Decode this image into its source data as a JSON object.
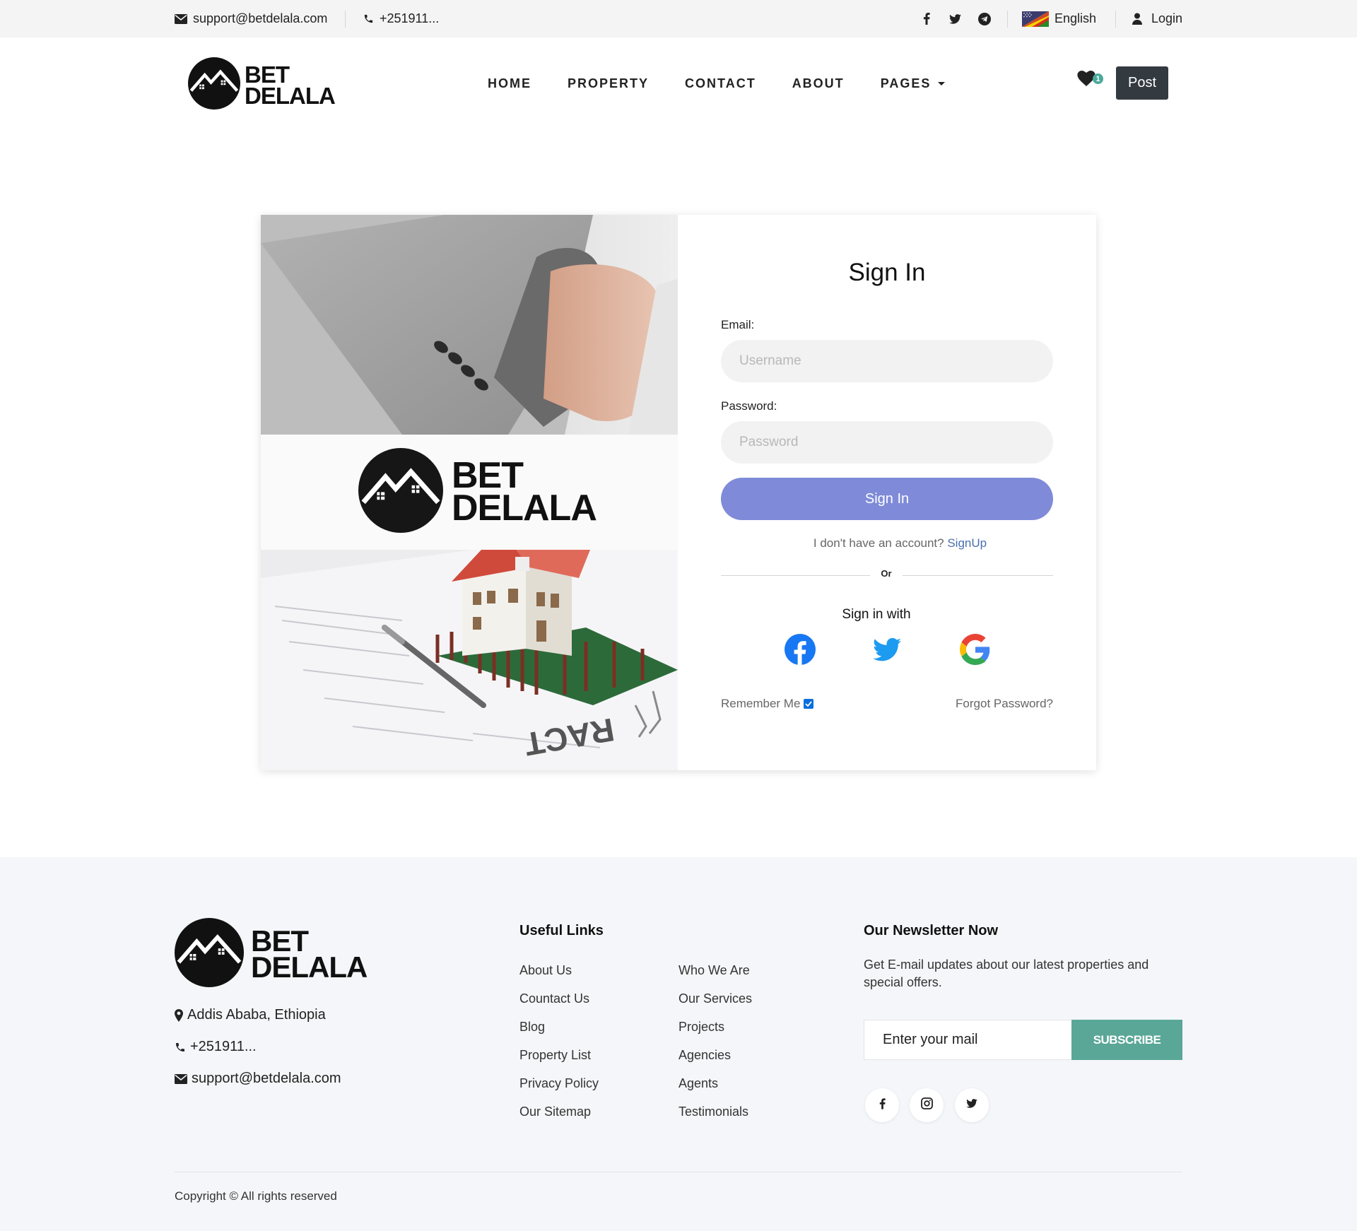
{
  "topbar": {
    "email": "support@betdelala.com",
    "phone": "+251911...",
    "language": "English",
    "login": "Login",
    "social_icons": [
      "facebook-icon",
      "twitter-icon",
      "telegram-icon"
    ]
  },
  "brand": {
    "line1": "BET",
    "line2": "DELALA"
  },
  "nav": {
    "items": [
      {
        "label": "HOME"
      },
      {
        "label": "PROPERTY"
      },
      {
        "label": "CONTACT"
      },
      {
        "label": "ABOUT"
      },
      {
        "label": "PAGES"
      }
    ],
    "favorites_count": "1",
    "post_label": "Post"
  },
  "signin": {
    "title": "Sign In",
    "email_label": "Email:",
    "email_placeholder": "Username",
    "password_label": "Password:",
    "password_placeholder": "Password",
    "button": "Sign In",
    "no_account_text": "I don't have an account?",
    "signup_link": "SignUp",
    "or": "Or",
    "sign_in_with": "Sign in with",
    "providers": [
      "facebook-logo",
      "twitter-logo",
      "google-logo"
    ],
    "remember_me": "Remember Me",
    "remember_checked": true,
    "forgot": "Forgot Password?"
  },
  "footer": {
    "address": "Addis Ababa, Ethiopia",
    "phone": "+251911...",
    "email": "support@betdelala.com",
    "useful_links_heading": "Useful Links",
    "links_col1": [
      "About Us",
      "Countact Us",
      "Blog",
      "Property List",
      "Privacy Policy",
      "Our Sitemap"
    ],
    "links_col2": [
      "Who We Are",
      "Our Services",
      "Projects",
      "Agencies",
      "Agents",
      "Testimonials"
    ],
    "newsletter_heading": "Our Newsletter Now",
    "newsletter_text": "Get E-mail updates about our latest properties and special offers.",
    "newsletter_placeholder": "Enter your mail",
    "subscribe": "SUBSCRIBE",
    "social_icons": [
      "facebook-icon",
      "instagram-icon",
      "twitter-icon"
    ],
    "copyright": "Copyright © All rights reserved"
  },
  "colors": {
    "accent_button": "#7f8bd8",
    "subscribe": "#5aa797",
    "post_button": "#333a40",
    "signup_link": "#4a6fb0"
  }
}
